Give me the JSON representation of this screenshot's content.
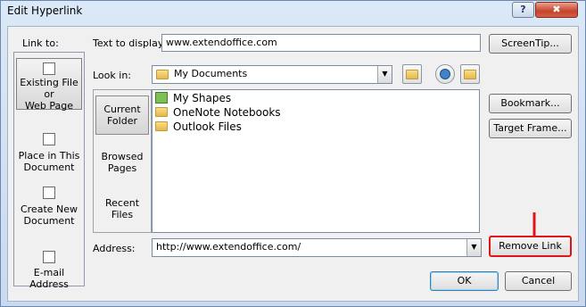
{
  "window": {
    "title": "Edit Hyperlink",
    "help_label": "?",
    "close_label": "✖"
  },
  "link_to": {
    "heading": "Link to:",
    "items": [
      {
        "label_line1": "Existing File or",
        "label_line2": "Web Page",
        "selected": true
      },
      {
        "label_line1": "Place in This",
        "label_line2": "Document",
        "selected": false
      },
      {
        "label_line1": "Create New",
        "label_line2": "Document",
        "selected": false
      },
      {
        "label_line1": "E-mail Address",
        "label_line2": "",
        "selected": false
      }
    ]
  },
  "text_to_display": {
    "label": "Text to display:",
    "value": "www.extendoffice.com"
  },
  "look_in": {
    "label": "Look in:",
    "value": "My Documents"
  },
  "subnav": {
    "items": [
      {
        "label_line1": "Current",
        "label_line2": "Folder",
        "selected": true
      },
      {
        "label_line1": "Browsed",
        "label_line2": "Pages",
        "selected": false
      },
      {
        "label_line1": "Recent",
        "label_line2": "Files",
        "selected": false
      }
    ]
  },
  "files": [
    {
      "name": "My Shapes",
      "icon": "shapes-icon"
    },
    {
      "name": "OneNote Notebooks",
      "icon": "folder-icon"
    },
    {
      "name": "Outlook Files",
      "icon": "folder-icon"
    }
  ],
  "address": {
    "label": "Address:",
    "value": "http://www.extendoffice.com/"
  },
  "buttons": {
    "screentip": "ScreenTip...",
    "bookmark": "Bookmark...",
    "target_frame": "Target Frame...",
    "remove_link": "Remove Link",
    "ok": "OK",
    "cancel": "Cancel"
  },
  "colors": {
    "highlight": "#e0151a"
  }
}
